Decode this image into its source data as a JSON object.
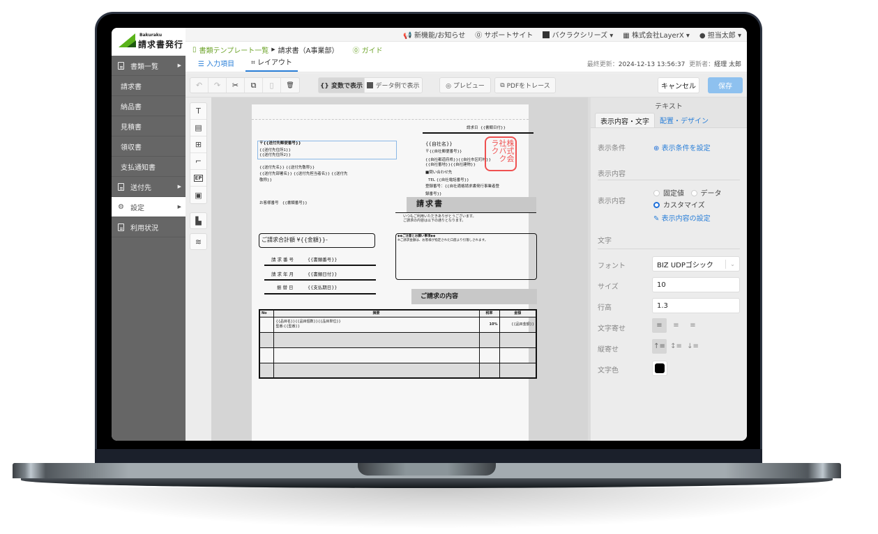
{
  "app": {
    "brand": "Bakuraku",
    "product": "請求書発行"
  },
  "topbar": {
    "news": "新機能/お知らせ",
    "support": "サポートサイト",
    "series": "バクラクシリーズ ▾",
    "company": "株式会社LayerX ▾",
    "user": "担当太郎 ▾"
  },
  "breadcrumb": {
    "root": "書類テンプレート一覧",
    "sep": "▶",
    "current": "請求書（A事業部）",
    "guide": "ガイド"
  },
  "tabs": {
    "input": "入力項目",
    "layout": "レイアウト",
    "updated_label": "最終更新：",
    "updated_value": "2024-12-13 13:56:37",
    "updater_label": "更新者：",
    "updater_value": "経理 太郎"
  },
  "sidebar": {
    "items": [
      {
        "label": "書類一覧",
        "icon": "document-icon",
        "caret": "▶"
      },
      {
        "label": "請求書"
      },
      {
        "label": "納品書"
      },
      {
        "label": "見積書"
      },
      {
        "label": "領収書"
      },
      {
        "label": "支払通知書"
      },
      {
        "label": "送付先",
        "icon": "document-icon",
        "caret": "▶"
      },
      {
        "label": "設定",
        "icon": "gear-icon",
        "caret": "▶",
        "active": true
      },
      {
        "label": "利用状況",
        "icon": "document-icon"
      }
    ]
  },
  "toolbar": {
    "undo": "↶",
    "redo": "↷",
    "cut": "✂",
    "copy": "⧉",
    "paste": "▯",
    "delete": "🗑",
    "var_view": "{} 変数で表示",
    "data_view": "データ例で表示",
    "preview": "◎ プレビュー",
    "trace": "PDFをトレース",
    "cancel": "キャンセル",
    "save": "保存"
  },
  "tools": [
    "T",
    "▤",
    "⊞",
    "⌐",
    "EP",
    "▣",
    "▙",
    "≋"
  ],
  "document": {
    "date_label": "請求日",
    "date_var": "{{書類日付}}",
    "recipient": [
      "〒{{送付先郵便番号}}",
      "{{送付先住所1}}",
      "{{送付先住所2}}"
    ],
    "recipient_name": [
      "{{送付先名}} {{送付先敬称}}",
      "{{送付先部署名}} {{送付先担当者名}} {{送付先",
      "敬称}}"
    ],
    "company": [
      "{{自社名}}",
      "〒{{自社郵便番号}}",
      "{{自社都道府県}}{{自社市区町村}}",
      "{{自社番地}}{{自社建物}}",
      "■問い合わせ先",
      "TEL {{自社電話番号}}",
      "登録番号：{{自社適格請求書発行事業者登",
      "録番号}}"
    ],
    "stamp": "株式会社バクラク",
    "customer_no_label": "お客様番号",
    "customer_no_var": "{{書類番号}}",
    "title": "請求書",
    "greeting": [
      "いつもご利用いただきありがとうございます。",
      "ご請求の内容は以下の通りとなります。"
    ],
    "total": "ご請求合計額 ¥{{金額}}-",
    "notes_title": "◆◆ご注意とお願い事項◆◆",
    "notes_body": "※ご請求金額は、お客様が指定された口座より引落しされます。",
    "fields": [
      {
        "label": "請求番号",
        "value": "{{書類番号}}"
      },
      {
        "label": "請求年月",
        "value": "{{書類日付}}"
      },
      {
        "label": "振替日",
        "value": "{{支払期日}}"
      }
    ],
    "detail_title": "ご請求の内容",
    "table": {
      "headers": [
        "No",
        "摘要",
        "税率",
        "金額"
      ],
      "row1": {
        "desc1": "{{品目名}}{{品目個数}}{{品目単位}}",
        "desc2": "型番:{{型番}}",
        "tax": "10%",
        "amount": "{{品目金額}}"
      }
    }
  },
  "panel": {
    "title": "テキスト",
    "tab_content": "表示内容・文字",
    "tab_design": "配置・デザイン",
    "cond_label": "表示条件",
    "cond_link": "表示条件を設定",
    "section_content": "表示内容",
    "content_label": "表示内容",
    "opt_fixed": "固定値",
    "opt_data": "データ",
    "opt_custom": "カスタマイズ",
    "content_link": "表示内容の設定",
    "section_text": "文字",
    "font_label": "フォント",
    "font_value": "BIZ UDPゴシック",
    "size_label": "サイズ",
    "size_value": "10",
    "lineheight_label": "行高",
    "lineheight_value": "1.3",
    "halign_label": "文字寄せ",
    "valign_label": "縦寄せ",
    "color_label": "文字色",
    "color_value": "#000000"
  }
}
